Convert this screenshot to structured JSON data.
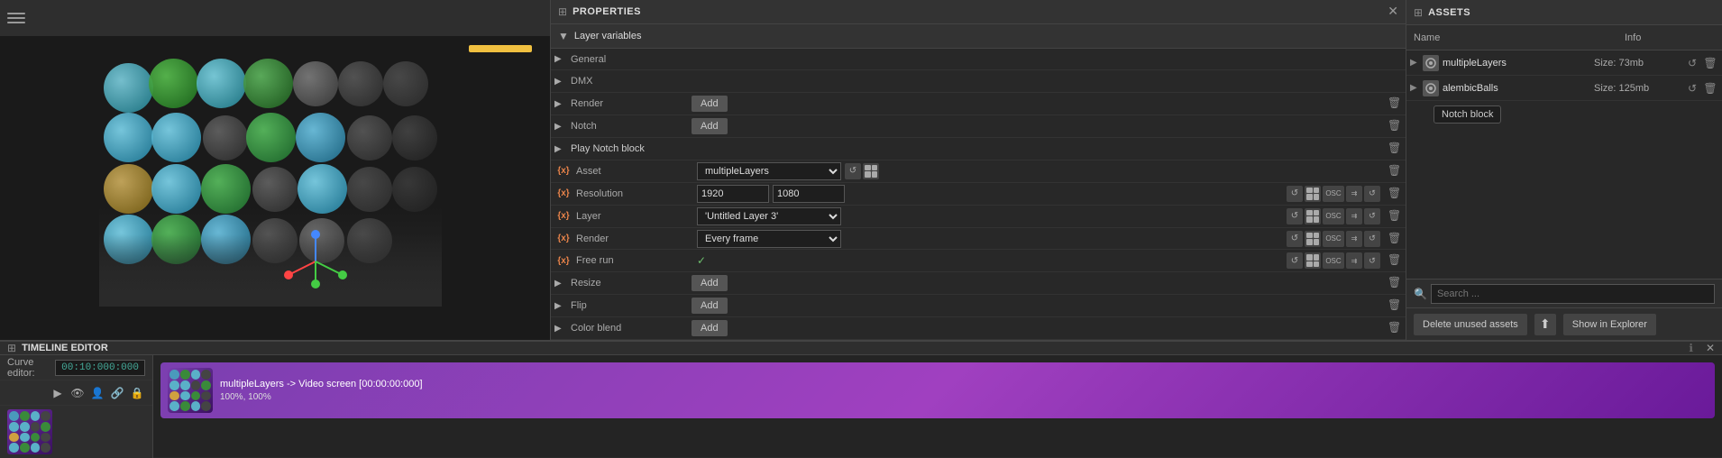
{
  "properties_panel": {
    "title": "PROPERTIES",
    "close_label": "✕",
    "section_layer_variables": "Layer variables",
    "rows": [
      {
        "type": "simple",
        "label": "General",
        "has_arrow": true
      },
      {
        "type": "simple",
        "label": "DMX",
        "has_arrow": true
      },
      {
        "type": "button",
        "label": "Render",
        "btn_label": "Add",
        "has_arrow": true
      },
      {
        "type": "button",
        "label": "Notch",
        "btn_label": "Add",
        "has_arrow": true
      },
      {
        "type": "play",
        "label": "Play Notch block",
        "has_arrow": true
      },
      {
        "type": "asset_row",
        "label": "Asset",
        "value": "multipleLayers",
        "has_dropdown": true
      },
      {
        "type": "two_input",
        "label": "Resolution",
        "val1": "1920",
        "val2": "1080"
      },
      {
        "type": "dropdown_row",
        "label": "Layer",
        "value": "'Untitled Layer 3'"
      },
      {
        "type": "dropdown_row2",
        "label": "Render",
        "value": "Every frame"
      },
      {
        "type": "check_row",
        "label": "Free run"
      },
      {
        "type": "button",
        "label": "Resize",
        "btn_label": "Add",
        "has_arrow": true
      },
      {
        "type": "button",
        "label": "Flip",
        "btn_label": "Add",
        "has_arrow": true
      },
      {
        "type": "button",
        "label": "Color blend",
        "btn_label": "Add",
        "has_arrow": true
      }
    ]
  },
  "assets_panel": {
    "title": "ASSETS",
    "col_name": "Name",
    "col_info": "Info",
    "assets": [
      {
        "name": "multipleLayers",
        "info": "Size: 73mb"
      },
      {
        "name": "alembicBalls",
        "info": "Size: 125mb"
      }
    ],
    "tooltip": "Notch block",
    "search_placeholder": "Search ...",
    "delete_btn": "Delete unused assets",
    "show_explorer_btn": "Show in Explorer"
  },
  "timeline": {
    "title": "TIMELINE EDITOR",
    "curve_editor_label": "Curve editor:",
    "time_display": "00:10:000:000",
    "track_label": "multipleLayers -> Video screen [00:00:00:000]",
    "track_sub": "100%, 100%",
    "close_label": "✕"
  },
  "icons": {
    "hamburger": "☰",
    "arrow_right": "▶",
    "arrow_down": "▼",
    "close": "✕",
    "trash": "🗑",
    "search": "🔍",
    "play": "▶",
    "eye": "👁",
    "person": "👤",
    "link": "🔗",
    "lock": "🔒",
    "filter": "⊞",
    "gear": "⚙",
    "export": "⬆",
    "refresh": "↺"
  }
}
